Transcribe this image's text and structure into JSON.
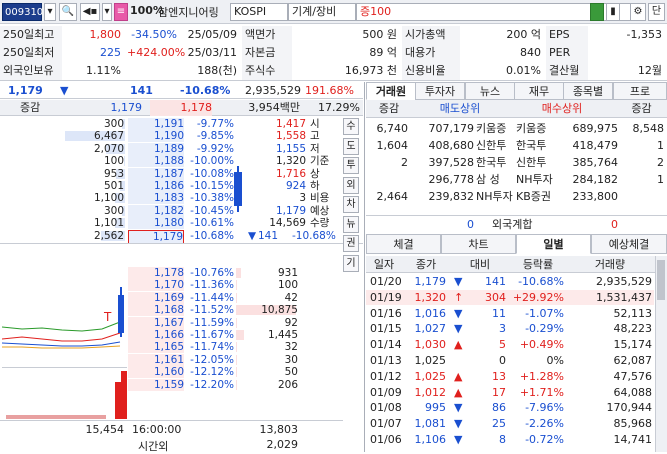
{
  "header": {
    "code": "009310",
    "percent": "100%",
    "name": "참엔지니어링",
    "market": "KOSPI",
    "sector": "기계/장비",
    "margin": "증100"
  },
  "info": {
    "rows": [
      [
        "250일최고",
        "1,800",
        "-34.50%",
        "25/05/09",
        "액면가",
        "500 원",
        "시가총액",
        "200 억",
        "EPS",
        "-1,353"
      ],
      [
        "250일최저",
        "225",
        "+424.00%",
        "25/03/11",
        "자본금",
        "89 억",
        "대용가",
        "840",
        "PER",
        ""
      ],
      [
        "외국인보유",
        "1.11%",
        "",
        "188(천)",
        "주식수",
        "16,973 천",
        "신용비율",
        "0.01%",
        "결산월",
        "12월"
      ]
    ]
  },
  "summary": {
    "price": "1,179",
    "arrow": "▼",
    "change": "141",
    "rate": "-10.68%",
    "volume": "2,935,529",
    "vrate": "191.68%"
  },
  "orderbook": {
    "header": {
      "label": "증감",
      "p1": "1,179",
      "p2": "1,178",
      "amount": "3,954백만",
      "pct": "17.29%"
    },
    "asks": [
      [
        "300",
        "1,191",
        "-9.77%"
      ],
      [
        "6,467",
        "1,190",
        "-9.85%"
      ],
      [
        "2,070",
        "1,189",
        "-9.92%"
      ],
      [
        "100",
        "1,188",
        "-10.00%"
      ],
      [
        "953",
        "1,187",
        "-10.08%"
      ],
      [
        "501",
        "1,186",
        "-10.15%"
      ],
      [
        "1,100",
        "1,183",
        "-10.38%"
      ],
      [
        "300",
        "1,182",
        "-10.45%"
      ],
      [
        "1,101",
        "1,180",
        "-10.61%"
      ],
      [
        "2,562",
        "1,179",
        "-10.68%"
      ]
    ],
    "bids": [
      [
        "1,178",
        "-10.76%",
        "931"
      ],
      [
        "1,170",
        "-11.36%",
        "100"
      ],
      [
        "1,169",
        "-11.44%",
        "42"
      ],
      [
        "1,168",
        "-11.52%",
        "10,875"
      ],
      [
        "1,167",
        "-11.59%",
        "92"
      ],
      [
        "1,166",
        "-11.67%",
        "1,445"
      ],
      [
        "1,165",
        "-11.74%",
        "32"
      ],
      [
        "1,161",
        "-12.05%",
        "30"
      ],
      [
        "1,160",
        "-12.12%",
        "50"
      ],
      [
        "1,159",
        "-12.20%",
        "206"
      ]
    ],
    "stats": [
      [
        "1,417",
        "시"
      ],
      [
        "1,558",
        "고"
      ],
      [
        "1,155",
        "저"
      ],
      [
        "1,320",
        "기준"
      ],
      [
        "1,716",
        "상"
      ],
      [
        "924",
        "하"
      ],
      [
        "3",
        "비용"
      ],
      [
        "1,179",
        "예상"
      ],
      [
        "14,569",
        "수량"
      ]
    ],
    "stat_colors": [
      "red",
      "red",
      "blue",
      "black",
      "red",
      "blue",
      "black",
      "blue",
      "black"
    ],
    "expected": {
      "arrow": "▼",
      "change": "141",
      "rate": "-10.68%"
    },
    "side_buttons": [
      "수",
      "도",
      "투",
      "외",
      "차",
      "뉴",
      "권",
      "기"
    ],
    "total_ask": "15,454",
    "time": "16:00:00",
    "total_bid": "13,803",
    "after_label": "시간외",
    "after_value": "2,029"
  },
  "broker_tabs": [
    "거래원",
    "투자자",
    "뉴스",
    "재무",
    "종목별",
    "프로"
  ],
  "broker": {
    "head": [
      "증감",
      "매도상위",
      "매수상위",
      "증감"
    ],
    "rows": [
      [
        "6,740",
        "707,179",
        "키움증",
        "키움증",
        "689,975",
        "8,548"
      ],
      [
        "1,604",
        "408,680",
        "신한투",
        "한국투",
        "418,479",
        "1"
      ],
      [
        "2",
        "397,528",
        "한국투",
        "신한투",
        "385,764",
        "2"
      ],
      [
        "",
        "296,778",
        "삼 성",
        "NH투자",
        "284,182",
        "1"
      ],
      [
        "2,464",
        "239,832",
        "NH투자",
        "KB증권",
        "233,800",
        ""
      ]
    ],
    "foreign": [
      "0",
      "외국계합",
      "0"
    ]
  },
  "bottom_tabs": [
    "체결",
    "차트",
    "일별",
    "예상체결"
  ],
  "daily": {
    "head": [
      "일자",
      "종가",
      "대비",
      "등락률",
      "거래량"
    ],
    "rows": [
      [
        "01/20",
        "1,179",
        "▼",
        "141",
        "-10.68%",
        "2,935,529"
      ],
      [
        "01/19",
        "1,320",
        "↑",
        "304",
        "+29.92%",
        "1,531,437"
      ],
      [
        "01/16",
        "1,016",
        "▼",
        "11",
        "-1.07%",
        "52,113"
      ],
      [
        "01/15",
        "1,027",
        "▼",
        "3",
        "-0.29%",
        "48,223"
      ],
      [
        "01/14",
        "1,030",
        "▲",
        "5",
        "+0.49%",
        "15,174"
      ],
      [
        "01/13",
        "1,025",
        "",
        "0",
        "0%",
        "62,087"
      ],
      [
        "01/12",
        "1,025",
        "▲",
        "13",
        "+1.28%",
        "47,576"
      ],
      [
        "01/09",
        "1,012",
        "▲",
        "17",
        "+1.71%",
        "64,088"
      ],
      [
        "01/08",
        "995",
        "▼",
        "86",
        "-7.96%",
        "170,944"
      ],
      [
        "01/07",
        "1,081",
        "▼",
        "25",
        "-2.26%",
        "85,968"
      ],
      [
        "01/06",
        "1,106",
        "▼",
        "8",
        "-0.72%",
        "14,741"
      ]
    ],
    "dirs": [
      "down",
      "up",
      "down",
      "down",
      "up",
      "none",
      "up",
      "up",
      "down",
      "down",
      "down"
    ]
  },
  "chart": {
    "marker": "T"
  }
}
